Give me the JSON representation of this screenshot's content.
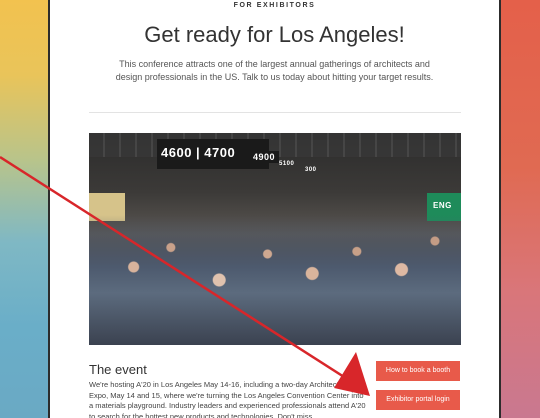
{
  "eyebrow": "FOR EXHIBITORS",
  "headline": "Get ready for Los Angeles!",
  "intro": "This conference attracts one of the largest annual gatherings of architects and design professionals in the US. Talk to us today about hitting your target results.",
  "photo": {
    "sign_main": "4600 | 4700",
    "sign_second": "4900",
    "sign_third": "5100",
    "sign_fourth": "300",
    "right_banner": "ENG"
  },
  "event": {
    "title": "The event",
    "body": "We're hosting A'20 in Los Angeles May 14-16, including a two-day Architecture Expo, May 14 and 15, where we're turning the Los Angeles Convention Center into a materials playground. Industry leaders and experienced professionals attend A'20 to search for the hottest new products and technologies. Don't miss"
  },
  "buttons": {
    "booth": "How to book a booth",
    "portal": "Exhibitor portal login"
  },
  "colors": {
    "accent": "#e85a4a",
    "annotation": "#d8262a"
  }
}
